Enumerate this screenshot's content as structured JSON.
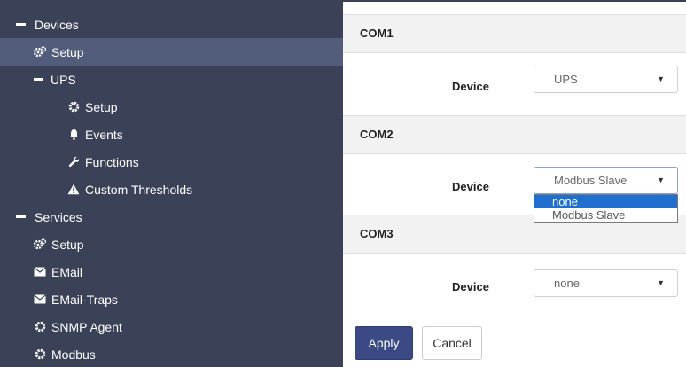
{
  "sidebar": {
    "items": [
      {
        "label": "Devices",
        "icon": "minus-icon",
        "level": 0,
        "active": false
      },
      {
        "label": "Setup",
        "icon": "cogs-icon",
        "level": 1,
        "active": true
      },
      {
        "label": "UPS",
        "icon": "minus-icon",
        "level": 1,
        "active": false
      },
      {
        "label": "Setup",
        "icon": "gear-icon",
        "level": 2,
        "active": false
      },
      {
        "label": "Events",
        "icon": "bell-icon",
        "level": 2,
        "active": false
      },
      {
        "label": "Functions",
        "icon": "wrench-icon",
        "level": 2,
        "active": false
      },
      {
        "label": "Custom Thresholds",
        "icon": "warning-icon",
        "level": 2,
        "active": false
      },
      {
        "label": "Services",
        "icon": "minus-icon",
        "level": 0,
        "active": false
      },
      {
        "label": "Setup",
        "icon": "cogs-icon",
        "level": 1,
        "active": false
      },
      {
        "label": "EMail",
        "icon": "envelope-icon",
        "level": 1,
        "active": false
      },
      {
        "label": "EMail-Traps",
        "icon": "envelope-icon",
        "level": 1,
        "active": false
      },
      {
        "label": "SNMP Agent",
        "icon": "gear-icon",
        "level": 1,
        "active": false
      },
      {
        "label": "Modbus",
        "icon": "gear-icon",
        "level": 1,
        "active": false
      }
    ]
  },
  "main": {
    "com1": {
      "title": "COM1",
      "device_label": "Device",
      "value": "UPS"
    },
    "com2": {
      "title": "COM2",
      "device_label": "Device",
      "value": "Modbus Slave",
      "options": [
        "none",
        "Modbus Slave"
      ],
      "highlighted": "none"
    },
    "com3": {
      "title": "COM3",
      "device_label": "Device",
      "value": "none"
    },
    "apply_label": "Apply",
    "cancel_label": "Cancel"
  },
  "colors": {
    "sidebar_bg": "#3b4257",
    "active_bg": "#525c7b",
    "primary": "#3b4a85",
    "highlight": "#1f6fd1"
  }
}
